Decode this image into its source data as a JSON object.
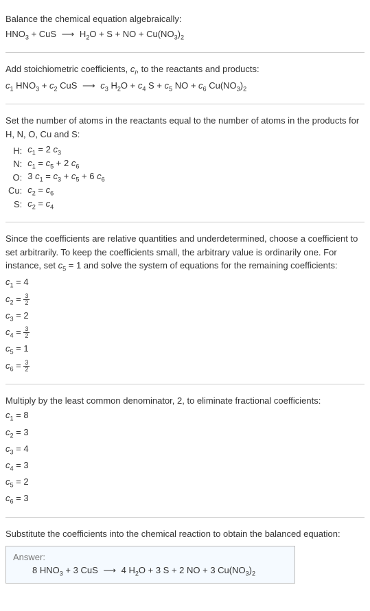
{
  "intro": {
    "line1": "Balance the chemical equation algebraically:",
    "eq_lhs_1": "HNO",
    "eq_lhs_1_sub": "3",
    "plus1": " + CuS ",
    "arrow": "⟶",
    "eq_rhs_1": " H",
    "eq_rhs_1_sub": "2",
    "eq_rhs_2": "O + S + NO + Cu(NO",
    "eq_rhs_2_sub": "3",
    "eq_rhs_3": ")",
    "eq_rhs_3_sub": "2"
  },
  "stoich": {
    "line1a": "Add stoichiometric coefficients, ",
    "ci_c": "c",
    "ci_i": "i",
    "line1b": ", to the reactants and products:",
    "c1": "c",
    "n1": "1",
    "t1": " HNO",
    "s1": "3",
    "p1": " + ",
    "c2": "c",
    "n2": "2",
    "t2": " CuS ",
    "arrow": "⟶",
    "c3": "c",
    "n3": "3",
    "t3": " H",
    "s3": "2",
    "t3b": "O + ",
    "c4": "c",
    "n4": "4",
    "t4": " S + ",
    "c5": "c",
    "n5": "5",
    "t5": " NO + ",
    "c6": "c",
    "n6": "6",
    "t6": " Cu(NO",
    "s6": "3",
    "t6b": ")",
    "s6b": "2"
  },
  "atoms": {
    "intro": "Set the number of atoms in the reactants equal to the number of atoms in the products for H, N, O, Cu and S:",
    "rows": [
      {
        "lab": "H:",
        "lhs_c": "c",
        "lhs_n": "1",
        "mid": " = 2 ",
        "rhs_c": "c",
        "rhs_n": "3",
        "tail": ""
      },
      {
        "lab": "N:",
        "lhs_c": "c",
        "lhs_n": "1",
        "mid": " = ",
        "rhs_c": "c",
        "rhs_n": "5",
        "tail_a": " + 2 ",
        "tail_c": "c",
        "tail_n": "6"
      },
      {
        "lab": "O:",
        "pre": "3 ",
        "lhs_c": "c",
        "lhs_n": "1",
        "mid": " = ",
        "rhs_c": "c",
        "rhs_n": "3",
        "tail_a": " + ",
        "tail_c": "c",
        "tail_n": "5",
        "tail_b": " + 6 ",
        "tail_d": "c",
        "tail_e": "6"
      },
      {
        "lab": "Cu:",
        "lhs_c": "c",
        "lhs_n": "2",
        "mid": " = ",
        "rhs_c": "c",
        "rhs_n": "6",
        "tail": ""
      },
      {
        "lab": "S:",
        "lhs_c": "c",
        "lhs_n": "2",
        "mid": " = ",
        "rhs_c": "c",
        "rhs_n": "4",
        "tail": ""
      }
    ]
  },
  "choose": {
    "para_a": "Since the coefficients are relative quantities and underdetermined, choose a coefficient to set arbitrarily. To keep the coefficients small, the arbitrary value is ordinarily one. For instance, set ",
    "cc": "c",
    "cn": "5",
    "para_b": " = 1 and solve the system of equations for the remaining coefficients:",
    "vals": [
      {
        "c": "c",
        "n": "1",
        "eq": " = 4"
      },
      {
        "c": "c",
        "n": "2",
        "eq": " = ",
        "frac_num": "3",
        "frac_den": "2"
      },
      {
        "c": "c",
        "n": "3",
        "eq": " = 2"
      },
      {
        "c": "c",
        "n": "4",
        "eq": " = ",
        "frac_num": "3",
        "frac_den": "2"
      },
      {
        "c": "c",
        "n": "5",
        "eq": " = 1"
      },
      {
        "c": "c",
        "n": "6",
        "eq": " = ",
        "frac_num": "3",
        "frac_den": "2"
      }
    ]
  },
  "mult": {
    "para": "Multiply by the least common denominator, 2, to eliminate fractional coefficients:",
    "vals": [
      {
        "c": "c",
        "n": "1",
        "eq": " = 8"
      },
      {
        "c": "c",
        "n": "2",
        "eq": " = 3"
      },
      {
        "c": "c",
        "n": "3",
        "eq": " = 4"
      },
      {
        "c": "c",
        "n": "4",
        "eq": " = 3"
      },
      {
        "c": "c",
        "n": "5",
        "eq": " = 2"
      },
      {
        "c": "c",
        "n": "6",
        "eq": " = 3"
      }
    ]
  },
  "subst": {
    "para": "Substitute the coefficients into the chemical reaction to obtain the balanced equation:"
  },
  "answer": {
    "title": "Answer:",
    "t1": "8 HNO",
    "s1": "3",
    "t2": " + 3 CuS ",
    "arrow": "⟶",
    "t3": " 4 H",
    "s3": "2",
    "t4": "O + 3 S + 2 NO + 3 Cu(NO",
    "s4": "3",
    "t5": ")",
    "s5": "2"
  }
}
